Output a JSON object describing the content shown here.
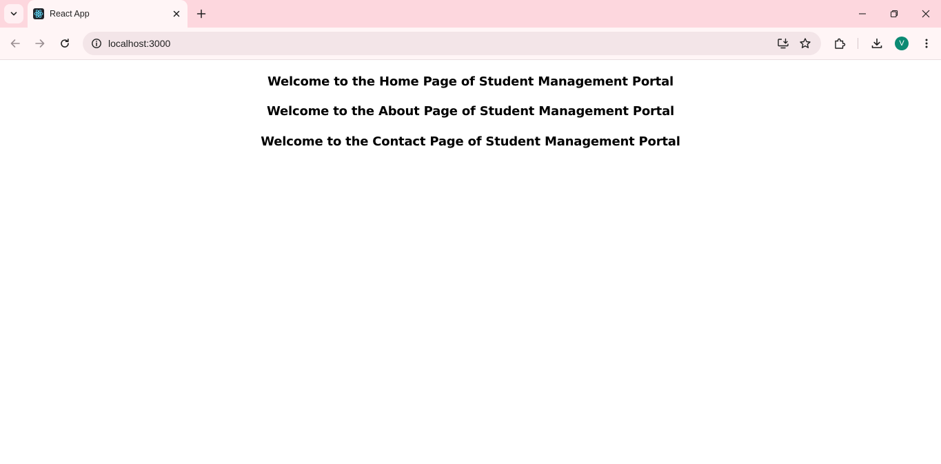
{
  "browser": {
    "tab": {
      "title": "React App",
      "favicon": "react-icon"
    },
    "address_bar": {
      "url": "localhost:3000"
    },
    "profile": {
      "initial": "V",
      "color": "#0b8a73"
    },
    "theme": {
      "tabstrip_color": "#fdd7de",
      "toolbar_color": "#fff5f6",
      "omnibox_color": "#f3e5e8"
    },
    "icons": {
      "tab_search": "chevron-down-icon",
      "tab_close": "close-icon",
      "new_tab": "plus-icon",
      "back": "back-arrow-icon",
      "forward": "forward-arrow-icon",
      "reload": "reload-icon",
      "site_info": "info-icon",
      "install_app": "install-icon",
      "bookmark": "star-icon",
      "extensions": "puzzle-icon",
      "downloads": "download-icon",
      "menu": "more-vert-icon",
      "minimize": "minimize-icon",
      "restore": "restore-icon",
      "close_window": "close-icon"
    }
  },
  "page": {
    "headings": [
      "Welcome to the Home Page of Student Management Portal",
      "Welcome to the About Page of Student Management Portal",
      "Welcome to the Contact Page of Student Management Portal"
    ]
  }
}
